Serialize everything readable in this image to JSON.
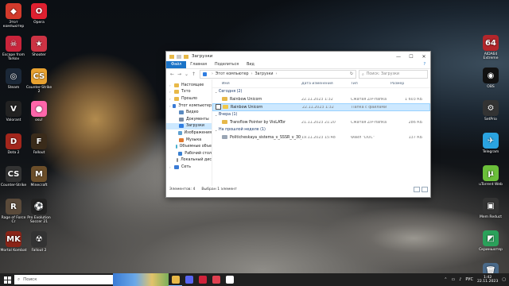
{
  "desktop_left": [
    {
      "label": "Этот компьютер",
      "color": "#d33a2c",
      "glyph": "◆"
    },
    {
      "label": "Opera",
      "color": "#e02030",
      "glyph": "O"
    },
    {
      "label": "Escape from Tarkov",
      "color": "#c9243b",
      "glyph": "☠"
    },
    {
      "label": "Shooter",
      "color": "#cc3344",
      "glyph": "★"
    },
    {
      "label": "Steam",
      "color": "#1b2838",
      "glyph": "◎"
    },
    {
      "label": "Counter-Strike 2",
      "color": "#e9a230",
      "glyph": "CS"
    },
    {
      "label": "Valorant",
      "color": "#222",
      "glyph": "V"
    },
    {
      "label": "osu!",
      "color": "#ff66aa",
      "glyph": "●"
    },
    {
      "label": "Dota 2",
      "color": "#a3261c",
      "glyph": "D"
    },
    {
      "label": "Fallout",
      "color": "#3a2b1a",
      "glyph": "F"
    },
    {
      "label": "Counter-Strike",
      "color": "#333",
      "glyph": "CS"
    },
    {
      "label": "Minecraft",
      "color": "#6b4e2a",
      "glyph": "M"
    },
    {
      "label": "Rage of Force Cr",
      "color": "#5a4a3a",
      "glyph": "R"
    },
    {
      "label": "Pro Evolution Soccer 21",
      "color": "#222",
      "glyph": "⚽"
    },
    {
      "label": "Mortal Kombat",
      "color": "#8a2418",
      "glyph": "MK"
    },
    {
      "label": "Fallout 2",
      "color": "#333",
      "glyph": "☢"
    }
  ],
  "desktop_right": [
    {
      "label": "AIDA64 Extreme",
      "color": "#b3262b",
      "glyph": "64"
    },
    {
      "label": "OBS",
      "color": "#111",
      "glyph": "◉"
    },
    {
      "label": "SetPrio",
      "color": "#333",
      "glyph": "⚙"
    },
    {
      "label": "Telegram",
      "color": "#2aa3e0",
      "glyph": "✈"
    },
    {
      "label": "uTorrent Web",
      "color": "#6bbf3a",
      "glyph": "µ"
    },
    {
      "label": "Mem Reduct",
      "color": "#333",
      "glyph": "▣"
    },
    {
      "label": "Скриншотер",
      "color": "#2aa15a",
      "glyph": "◩"
    },
    {
      "label": "Корзина",
      "color": "#4a6a8a",
      "glyph": "🗑"
    }
  ],
  "window": {
    "title": "Загрузки",
    "ribbon": {
      "file": "Файл",
      "home": "Главная",
      "share": "Поделиться",
      "view": "Вид"
    },
    "address": {
      "root": "Этот компьютер",
      "folder": "Загрузки"
    },
    "search_placeholder": "Поиск: Загрузки",
    "nav": [
      {
        "label": "Настоящее",
        "color": "#e8b948",
        "sub": false
      },
      {
        "label": "Тхто",
        "color": "#e8b948",
        "sub": false
      },
      {
        "label": "Прошло",
        "color": "#e8b948",
        "sub": false
      },
      {
        "label": "Этот компьютер",
        "color": "#3a7bd5",
        "sub": false
      },
      {
        "label": "Видео",
        "color": "#5a8ac0",
        "sub": true
      },
      {
        "label": "Документы",
        "color": "#7a8aa0",
        "sub": true
      },
      {
        "label": "Загрузки",
        "color": "#2f7de1",
        "sub": true,
        "selected": true
      },
      {
        "label": "Изображения",
        "color": "#5fa0d0",
        "sub": true
      },
      {
        "label": "Музыка",
        "color": "#e07a30",
        "sub": true
      },
      {
        "label": "Объемные объе",
        "color": "#4ab0d0",
        "sub": true
      },
      {
        "label": "Рабочий стол",
        "color": "#3a80d0",
        "sub": true
      },
      {
        "label": "Локальный дис",
        "color": "#888",
        "sub": true
      },
      {
        "label": "Сеть",
        "color": "#3a7bd5",
        "sub": false
      }
    ],
    "columns": {
      "name": "Имя",
      "date": "Дата изменения",
      "type": "Тип",
      "size": "Размер"
    },
    "groups": [
      {
        "title": "Сегодня (2)",
        "rows": [
          {
            "name": "Rainbow Unicorn",
            "date": "22.11.2023 1:32",
            "type": "Сжатая ZIP-папка",
            "size": "1 603 КБ",
            "icon_color": "#e6b84a",
            "selected": false
          },
          {
            "name": "Rainbow Unicorn",
            "date": "22.11.2023 1:32",
            "type": "Папка с файлами",
            "size": "",
            "icon_color": "#f0c84a",
            "selected": true
          }
        ]
      },
      {
        "title": "Вчера (1)",
        "rows": [
          {
            "name": "Transflow Pointer by VioLATor",
            "date": "21.11.2023 21:20",
            "type": "Сжатая ZIP-папка",
            "size": "286 КБ",
            "icon_color": "#e6b84a",
            "selected": false
          }
        ]
      },
      {
        "title": "На прошлой неделе (1)",
        "rows": [
          {
            "name": "Politicheskaya_sistema_v_SSSR_v_30_m...",
            "date": "19.11.2023 15:48",
            "type": "Файл \"DOC\"",
            "size": "137 КБ",
            "icon_color": "#9aa6b5",
            "selected": false
          }
        ]
      }
    ],
    "status": {
      "count": "Элементов: 4",
      "selected": "Выбран 1 элемент"
    }
  },
  "taskbar": {
    "search_label": "Поиск",
    "apps": [
      {
        "name": "explorer",
        "color": "#e8b948",
        "active": true
      },
      {
        "name": "discord",
        "color": "#5865f2",
        "active": false
      },
      {
        "name": "recorder",
        "color": "#d0223a",
        "active": false
      },
      {
        "name": "app-red",
        "color": "#e04050",
        "active": false
      },
      {
        "name": "app-white",
        "color": "#ffffff",
        "active": false
      }
    ],
    "lang": "РУС",
    "time": "1:42",
    "date": "22.11.2023"
  }
}
